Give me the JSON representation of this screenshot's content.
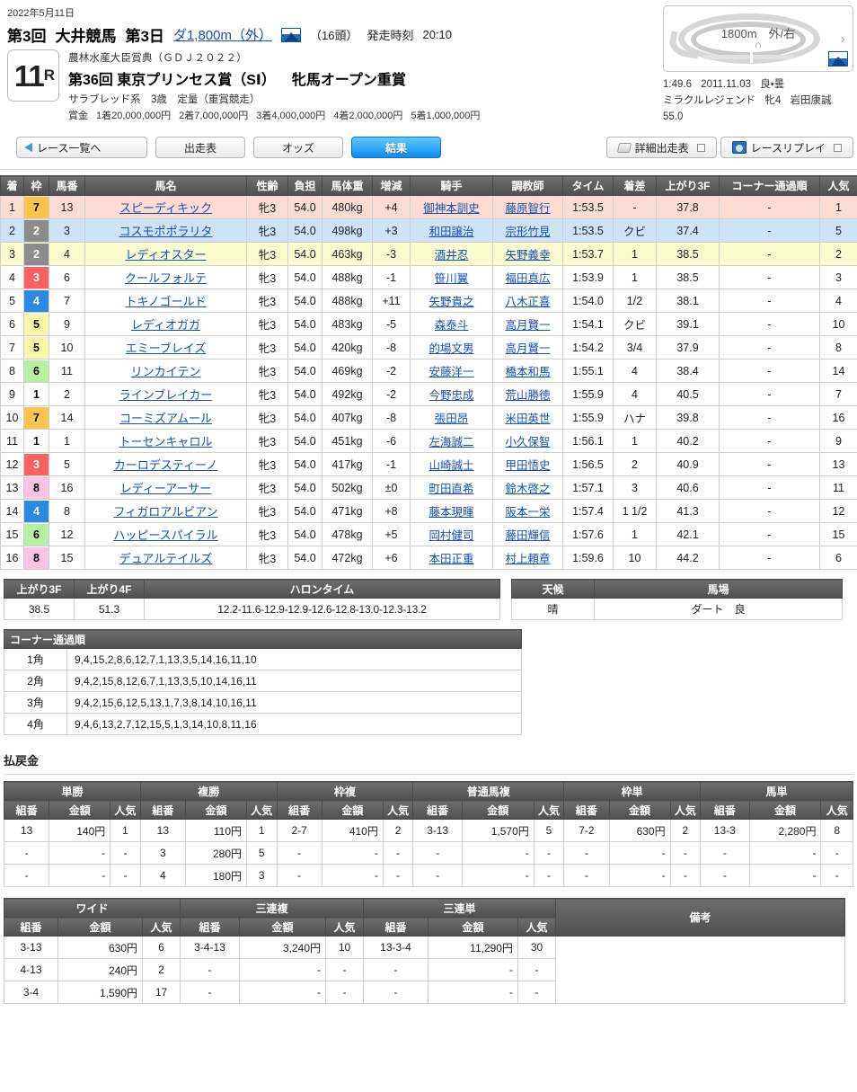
{
  "header": {
    "date": "2022年5月11日",
    "meeting": "第3回",
    "venue": "大井競馬",
    "day": "第3日",
    "course_link": "ダ1,800m（外）",
    "weather_icon": "wave-icon",
    "field_size": "（16頭）",
    "post_time_label": "発走時刻",
    "post_time": "20:10",
    "race_number": "11",
    "race_number_suffix": "R",
    "grade_sub": "農林水産大臣賞典（ＧＤＪ２０２２）",
    "race_title": "第36回 東京プリンセス賞（SⅠ）",
    "race_title2": "牝馬オープン重賞",
    "conditions": "サラブレッド系　3歳　定量（重賞競走）",
    "prize_label": "賞金",
    "prizes": [
      "1着20,000,000円",
      "2着7,000,000円",
      "3着4,000,000円",
      "4着2,000,000円",
      "5着1,000,000円"
    ]
  },
  "track_card": {
    "distance": "1800m　外/右",
    "shape_mark": "∩",
    "chevron": "›",
    "record_time": "1:49.6",
    "record_date": "2011.11.03",
    "record_cond": "良・曇",
    "record_horse": "ミラクルレジェンド",
    "record_sexage": "牝4",
    "record_jockey": "岩田康誠",
    "record_weight": "55.0"
  },
  "nav": {
    "back": "レース一覧へ",
    "entries": "出走表",
    "odds": "オッズ",
    "result": "結果",
    "detail_entries": "詳細出走表",
    "race_replay": "レースリプレイ"
  },
  "result_table": {
    "columns": [
      "着",
      "枠",
      "馬番",
      "馬名",
      "性齢",
      "負担",
      "馬体重",
      "増減",
      "騎手",
      "調教師",
      "タイム",
      "着差",
      "上がり3F",
      "コーナー通過順",
      "人気"
    ],
    "rows": [
      {
        "rank": "1",
        "waku": "7",
        "umaban": "13",
        "name": "スピーディキック",
        "sexage": "牝3",
        "weight": "54.0",
        "bw": "480kg",
        "diff": "+4",
        "jockey": "御神本訓史",
        "trainer": "藤原智行",
        "time": "1:53.5",
        "margin": "-",
        "last3f": "37.8",
        "corner": "-",
        "pop": "1"
      },
      {
        "rank": "2",
        "waku": "2",
        "umaban": "3",
        "name": "コスモポポラリタ",
        "sexage": "牝3",
        "weight": "54.0",
        "bw": "498kg",
        "diff": "+3",
        "jockey": "和田譲治",
        "trainer": "宗形竹見",
        "time": "1:53.5",
        "margin": "クビ",
        "last3f": "37.4",
        "corner": "-",
        "pop": "5"
      },
      {
        "rank": "3",
        "waku": "2",
        "umaban": "4",
        "name": "レディオスター",
        "sexage": "牝3",
        "weight": "54.0",
        "bw": "463kg",
        "diff": "-3",
        "jockey": "酒井忍",
        "trainer": "矢野義幸",
        "time": "1:53.7",
        "margin": "1",
        "last3f": "38.5",
        "corner": "-",
        "pop": "2"
      },
      {
        "rank": "4",
        "waku": "3",
        "umaban": "6",
        "name": "クールフォルテ",
        "sexage": "牝3",
        "weight": "54.0",
        "bw": "488kg",
        "diff": "-1",
        "jockey": "笹川翼",
        "trainer": "福田真広",
        "time": "1:53.9",
        "margin": "1",
        "last3f": "38.5",
        "corner": "-",
        "pop": "3"
      },
      {
        "rank": "5",
        "waku": "4",
        "umaban": "7",
        "name": "トキノゴールド",
        "sexage": "牝3",
        "weight": "54.0",
        "bw": "488kg",
        "diff": "+11",
        "jockey": "矢野貴之",
        "trainer": "八木正喜",
        "time": "1:54.0",
        "margin": "1/2",
        "last3f": "38.1",
        "corner": "-",
        "pop": "4"
      },
      {
        "rank": "6",
        "waku": "5",
        "umaban": "9",
        "name": "レディオガガ",
        "sexage": "牝3",
        "weight": "54.0",
        "bw": "483kg",
        "diff": "-5",
        "jockey": "森泰斗",
        "trainer": "高月賢一",
        "time": "1:54.1",
        "margin": "クビ",
        "last3f": "39.1",
        "corner": "-",
        "pop": "10"
      },
      {
        "rank": "7",
        "waku": "5",
        "umaban": "10",
        "name": "エミーブレイズ",
        "sexage": "牝3",
        "weight": "54.0",
        "bw": "420kg",
        "diff": "-8",
        "jockey": "的場文男",
        "trainer": "高月賢一",
        "time": "1:54.2",
        "margin": "3/4",
        "last3f": "37.9",
        "corner": "-",
        "pop": "8"
      },
      {
        "rank": "8",
        "waku": "6",
        "umaban": "11",
        "name": "リンカイテン",
        "sexage": "牝3",
        "weight": "54.0",
        "bw": "469kg",
        "diff": "-2",
        "jockey": "安藤洋一",
        "trainer": "橋本和馬",
        "time": "1:55.1",
        "margin": "4",
        "last3f": "38.4",
        "corner": "-",
        "pop": "14"
      },
      {
        "rank": "9",
        "waku": "1",
        "umaban": "2",
        "name": "ラインブレイカー",
        "sexage": "牝3",
        "weight": "54.0",
        "bw": "492kg",
        "diff": "-2",
        "jockey": "今野忠成",
        "trainer": "荒山勝徳",
        "time": "1:55.9",
        "margin": "4",
        "last3f": "40.5",
        "corner": "-",
        "pop": "7"
      },
      {
        "rank": "10",
        "waku": "7",
        "umaban": "14",
        "name": "コーミズアムール",
        "sexage": "牝3",
        "weight": "54.0",
        "bw": "407kg",
        "diff": "-8",
        "jockey": "張田昂",
        "trainer": "米田英世",
        "time": "1:55.9",
        "margin": "ハナ",
        "last3f": "39.8",
        "corner": "-",
        "pop": "16"
      },
      {
        "rank": "11",
        "waku": "1",
        "umaban": "1",
        "name": "トーセンキャロル",
        "sexage": "牝3",
        "weight": "54.0",
        "bw": "451kg",
        "diff": "-6",
        "jockey": "左海誠二",
        "trainer": "小久保智",
        "time": "1:56.1",
        "margin": "1",
        "last3f": "40.2",
        "corner": "-",
        "pop": "9"
      },
      {
        "rank": "12",
        "waku": "3",
        "umaban": "5",
        "name": "カーロデスティーノ",
        "sexage": "牝3",
        "weight": "54.0",
        "bw": "417kg",
        "diff": "-1",
        "jockey": "山崎誠士",
        "trainer": "甲田悟史",
        "time": "1:56.5",
        "margin": "2",
        "last3f": "40.9",
        "corner": "-",
        "pop": "13"
      },
      {
        "rank": "13",
        "waku": "8",
        "umaban": "16",
        "name": "レディーアーサー",
        "sexage": "牝3",
        "weight": "54.0",
        "bw": "502kg",
        "diff": "±0",
        "jockey": "町田直希",
        "trainer": "鈴木啓之",
        "time": "1:57.1",
        "margin": "3",
        "last3f": "40.6",
        "corner": "-",
        "pop": "11"
      },
      {
        "rank": "14",
        "waku": "4",
        "umaban": "8",
        "name": "フィガロアルビアン",
        "sexage": "牝3",
        "weight": "54.0",
        "bw": "471kg",
        "diff": "+8",
        "jockey": "藤本現暉",
        "trainer": "阪本一栄",
        "time": "1:57.4",
        "margin": "1 1/2",
        "last3f": "41.3",
        "corner": "-",
        "pop": "12"
      },
      {
        "rank": "15",
        "waku": "6",
        "umaban": "12",
        "name": "ハッピースパイラル",
        "sexage": "牝3",
        "weight": "54.0",
        "bw": "478kg",
        "diff": "+5",
        "jockey": "岡村健司",
        "trainer": "藤田輝信",
        "time": "1:57.6",
        "margin": "1",
        "last3f": "42.1",
        "corner": "-",
        "pop": "15"
      },
      {
        "rank": "16",
        "waku": "8",
        "umaban": "15",
        "name": "デュアルテイルズ",
        "sexage": "牝3",
        "weight": "54.0",
        "bw": "472kg",
        "diff": "+6",
        "jockey": "本田正重",
        "trainer": "村上頼章",
        "time": "1:59.6",
        "margin": "10",
        "last3f": "44.2",
        "corner": "-",
        "pop": "6"
      }
    ]
  },
  "lap_table": {
    "columns": [
      "上がり3F",
      "上がり4F",
      "ハロンタイム"
    ],
    "last3f": "38.5",
    "last4f": "51.3",
    "halon": "12.2-11.6-12.9-12.9-12.6-12.8-13.0-12.3-13.2"
  },
  "condition_table": {
    "columns": [
      "天候",
      "馬場"
    ],
    "weather": "晴",
    "track": "ダート　良"
  },
  "corner_table": {
    "title": "コーナー通過順",
    "rows": [
      {
        "corner": "1角",
        "order": "9,4,15,2,8,6,12,7,1,13,3,5,14,16,11,10"
      },
      {
        "corner": "2角",
        "order": "9,4,2,15,8,12,6,7,1,13,3,5,10,14,16,11"
      },
      {
        "corner": "3角",
        "order": "9,4,2,15,6,12,5,13,1,7,3,8,14,10,16,11"
      },
      {
        "corner": "4角",
        "order": "9,4,6,13,2,7,12,15,5,1,3,14,10,8,11,16"
      }
    ]
  },
  "payouts": {
    "title": "払戻金",
    "sub_columns": [
      "組番",
      "金額",
      "人気"
    ],
    "top_groups": [
      {
        "name": "単勝",
        "rows": [
          {
            "combo": "13",
            "amount": "140円",
            "pop": "1"
          },
          {
            "combo": "-",
            "amount": "-",
            "pop": "-"
          },
          {
            "combo": "-",
            "amount": "-",
            "pop": "-"
          }
        ]
      },
      {
        "name": "複勝",
        "rows": [
          {
            "combo": "13",
            "amount": "110円",
            "pop": "1"
          },
          {
            "combo": "3",
            "amount": "280円",
            "pop": "5"
          },
          {
            "combo": "4",
            "amount": "180円",
            "pop": "3"
          }
        ]
      },
      {
        "name": "枠複",
        "rows": [
          {
            "combo": "2-7",
            "amount": "410円",
            "pop": "2"
          },
          {
            "combo": "-",
            "amount": "-",
            "pop": "-"
          },
          {
            "combo": "-",
            "amount": "-",
            "pop": "-"
          }
        ]
      },
      {
        "name": "普通馬複",
        "rows": [
          {
            "combo": "3-13",
            "amount": "1,570円",
            "pop": "5"
          },
          {
            "combo": "-",
            "amount": "-",
            "pop": "-"
          },
          {
            "combo": "-",
            "amount": "-",
            "pop": "-"
          }
        ]
      },
      {
        "name": "枠単",
        "rows": [
          {
            "combo": "7-2",
            "amount": "630円",
            "pop": "2"
          },
          {
            "combo": "-",
            "amount": "-",
            "pop": "-"
          },
          {
            "combo": "-",
            "amount": "-",
            "pop": "-"
          }
        ]
      },
      {
        "name": "馬単",
        "rows": [
          {
            "combo": "13-3",
            "amount": "2,280円",
            "pop": "8"
          },
          {
            "combo": "-",
            "amount": "-",
            "pop": "-"
          },
          {
            "combo": "-",
            "amount": "-",
            "pop": "-"
          }
        ]
      }
    ],
    "bottom_groups": [
      {
        "name": "ワイド",
        "rows": [
          {
            "combo": "3-13",
            "amount": "630円",
            "pop": "6"
          },
          {
            "combo": "4-13",
            "amount": "240円",
            "pop": "2"
          },
          {
            "combo": "3-4",
            "amount": "1,590円",
            "pop": "17"
          }
        ]
      },
      {
        "name": "三連複",
        "rows": [
          {
            "combo": "3-4-13",
            "amount": "3,240円",
            "pop": "10"
          },
          {
            "combo": "-",
            "amount": "-",
            "pop": "-"
          },
          {
            "combo": "-",
            "amount": "-",
            "pop": "-"
          }
        ]
      },
      {
        "name": "三連単",
        "rows": [
          {
            "combo": "13-3-4",
            "amount": "11,290円",
            "pop": "30"
          },
          {
            "combo": "-",
            "amount": "-",
            "pop": "-"
          },
          {
            "combo": "-",
            "amount": "-",
            "pop": "-"
          }
        ]
      }
    ],
    "remarks_label": "備考",
    "remarks": ""
  }
}
